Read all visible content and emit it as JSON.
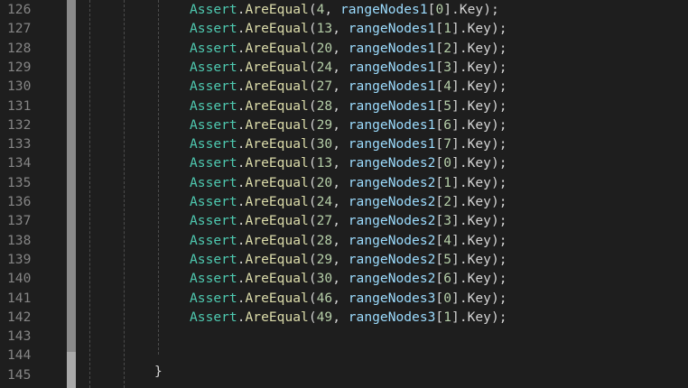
{
  "editor": {
    "colors": {
      "background": "#1e1e1e",
      "line_number": "#858585",
      "class": "#4ec9b0",
      "method": "#dcdcaa",
      "number": "#b5cea8",
      "variable": "#9cdcfe",
      "punctuation": "#d4d4d4"
    },
    "line_numbers": [
      "126",
      "127",
      "128",
      "129",
      "130",
      "131",
      "132",
      "133",
      "134",
      "135",
      "136",
      "137",
      "138",
      "139",
      "140",
      "141",
      "142",
      "143",
      "144",
      "145"
    ],
    "lines": [
      {
        "cls": "Assert",
        "dot": ".",
        "mth": "AreEqual",
        "open": "(",
        "num": "4",
        "sep": ", ",
        "var": "rangeNodes1",
        "idx_open": "[",
        "idx": "0",
        "idx_close": "]",
        "prop": ".Key",
        "close": ");"
      },
      {
        "cls": "Assert",
        "dot": ".",
        "mth": "AreEqual",
        "open": "(",
        "num": "13",
        "sep": ", ",
        "var": "rangeNodes1",
        "idx_open": "[",
        "idx": "1",
        "idx_close": "]",
        "prop": ".Key",
        "close": ");"
      },
      {
        "cls": "Assert",
        "dot": ".",
        "mth": "AreEqual",
        "open": "(",
        "num": "20",
        "sep": ", ",
        "var": "rangeNodes1",
        "idx_open": "[",
        "idx": "2",
        "idx_close": "]",
        "prop": ".Key",
        "close": ");"
      },
      {
        "cls": "Assert",
        "dot": ".",
        "mth": "AreEqual",
        "open": "(",
        "num": "24",
        "sep": ", ",
        "var": "rangeNodes1",
        "idx_open": "[",
        "idx": "3",
        "idx_close": "]",
        "prop": ".Key",
        "close": ");"
      },
      {
        "cls": "Assert",
        "dot": ".",
        "mth": "AreEqual",
        "open": "(",
        "num": "27",
        "sep": ", ",
        "var": "rangeNodes1",
        "idx_open": "[",
        "idx": "4",
        "idx_close": "]",
        "prop": ".Key",
        "close": ");"
      },
      {
        "cls": "Assert",
        "dot": ".",
        "mth": "AreEqual",
        "open": "(",
        "num": "28",
        "sep": ", ",
        "var": "rangeNodes1",
        "idx_open": "[",
        "idx": "5",
        "idx_close": "]",
        "prop": ".Key",
        "close": ");"
      },
      {
        "cls": "Assert",
        "dot": ".",
        "mth": "AreEqual",
        "open": "(",
        "num": "29",
        "sep": ", ",
        "var": "rangeNodes1",
        "idx_open": "[",
        "idx": "6",
        "idx_close": "]",
        "prop": ".Key",
        "close": ");"
      },
      {
        "cls": "Assert",
        "dot": ".",
        "mth": "AreEqual",
        "open": "(",
        "num": "30",
        "sep": ", ",
        "var": "rangeNodes1",
        "idx_open": "[",
        "idx": "7",
        "idx_close": "]",
        "prop": ".Key",
        "close": ");"
      },
      {
        "cls": "Assert",
        "dot": ".",
        "mth": "AreEqual",
        "open": "(",
        "num": "13",
        "sep": ", ",
        "var": "rangeNodes2",
        "idx_open": "[",
        "idx": "0",
        "idx_close": "]",
        "prop": ".Key",
        "close": ");"
      },
      {
        "cls": "Assert",
        "dot": ".",
        "mth": "AreEqual",
        "open": "(",
        "num": "20",
        "sep": ", ",
        "var": "rangeNodes2",
        "idx_open": "[",
        "idx": "1",
        "idx_close": "]",
        "prop": ".Key",
        "close": ");"
      },
      {
        "cls": "Assert",
        "dot": ".",
        "mth": "AreEqual",
        "open": "(",
        "num": "24",
        "sep": ", ",
        "var": "rangeNodes2",
        "idx_open": "[",
        "idx": "2",
        "idx_close": "]",
        "prop": ".Key",
        "close": ");"
      },
      {
        "cls": "Assert",
        "dot": ".",
        "mth": "AreEqual",
        "open": "(",
        "num": "27",
        "sep": ", ",
        "var": "rangeNodes2",
        "idx_open": "[",
        "idx": "3",
        "idx_close": "]",
        "prop": ".Key",
        "close": ");"
      },
      {
        "cls": "Assert",
        "dot": ".",
        "mth": "AreEqual",
        "open": "(",
        "num": "28",
        "sep": ", ",
        "var": "rangeNodes2",
        "idx_open": "[",
        "idx": "4",
        "idx_close": "]",
        "prop": ".Key",
        "close": ");"
      },
      {
        "cls": "Assert",
        "dot": ".",
        "mth": "AreEqual",
        "open": "(",
        "num": "29",
        "sep": ", ",
        "var": "rangeNodes2",
        "idx_open": "[",
        "idx": "5",
        "idx_close": "]",
        "prop": ".Key",
        "close": ");"
      },
      {
        "cls": "Assert",
        "dot": ".",
        "mth": "AreEqual",
        "open": "(",
        "num": "30",
        "sep": ", ",
        "var": "rangeNodes2",
        "idx_open": "[",
        "idx": "6",
        "idx_close": "]",
        "prop": ".Key",
        "close": ");"
      },
      {
        "cls": "Assert",
        "dot": ".",
        "mth": "AreEqual",
        "open": "(",
        "num": "46",
        "sep": ", ",
        "var": "rangeNodes3",
        "idx_open": "[",
        "idx": "0",
        "idx_close": "]",
        "prop": ".Key",
        "close": ");"
      },
      {
        "cls": "Assert",
        "dot": ".",
        "mth": "AreEqual",
        "open": "(",
        "num": "49",
        "sep": ", ",
        "var": "rangeNodes3",
        "idx_open": "[",
        "idx": "1",
        "idx_close": "]",
        "prop": ".Key",
        "close": ");"
      }
    ],
    "closing_brace": "}"
  }
}
